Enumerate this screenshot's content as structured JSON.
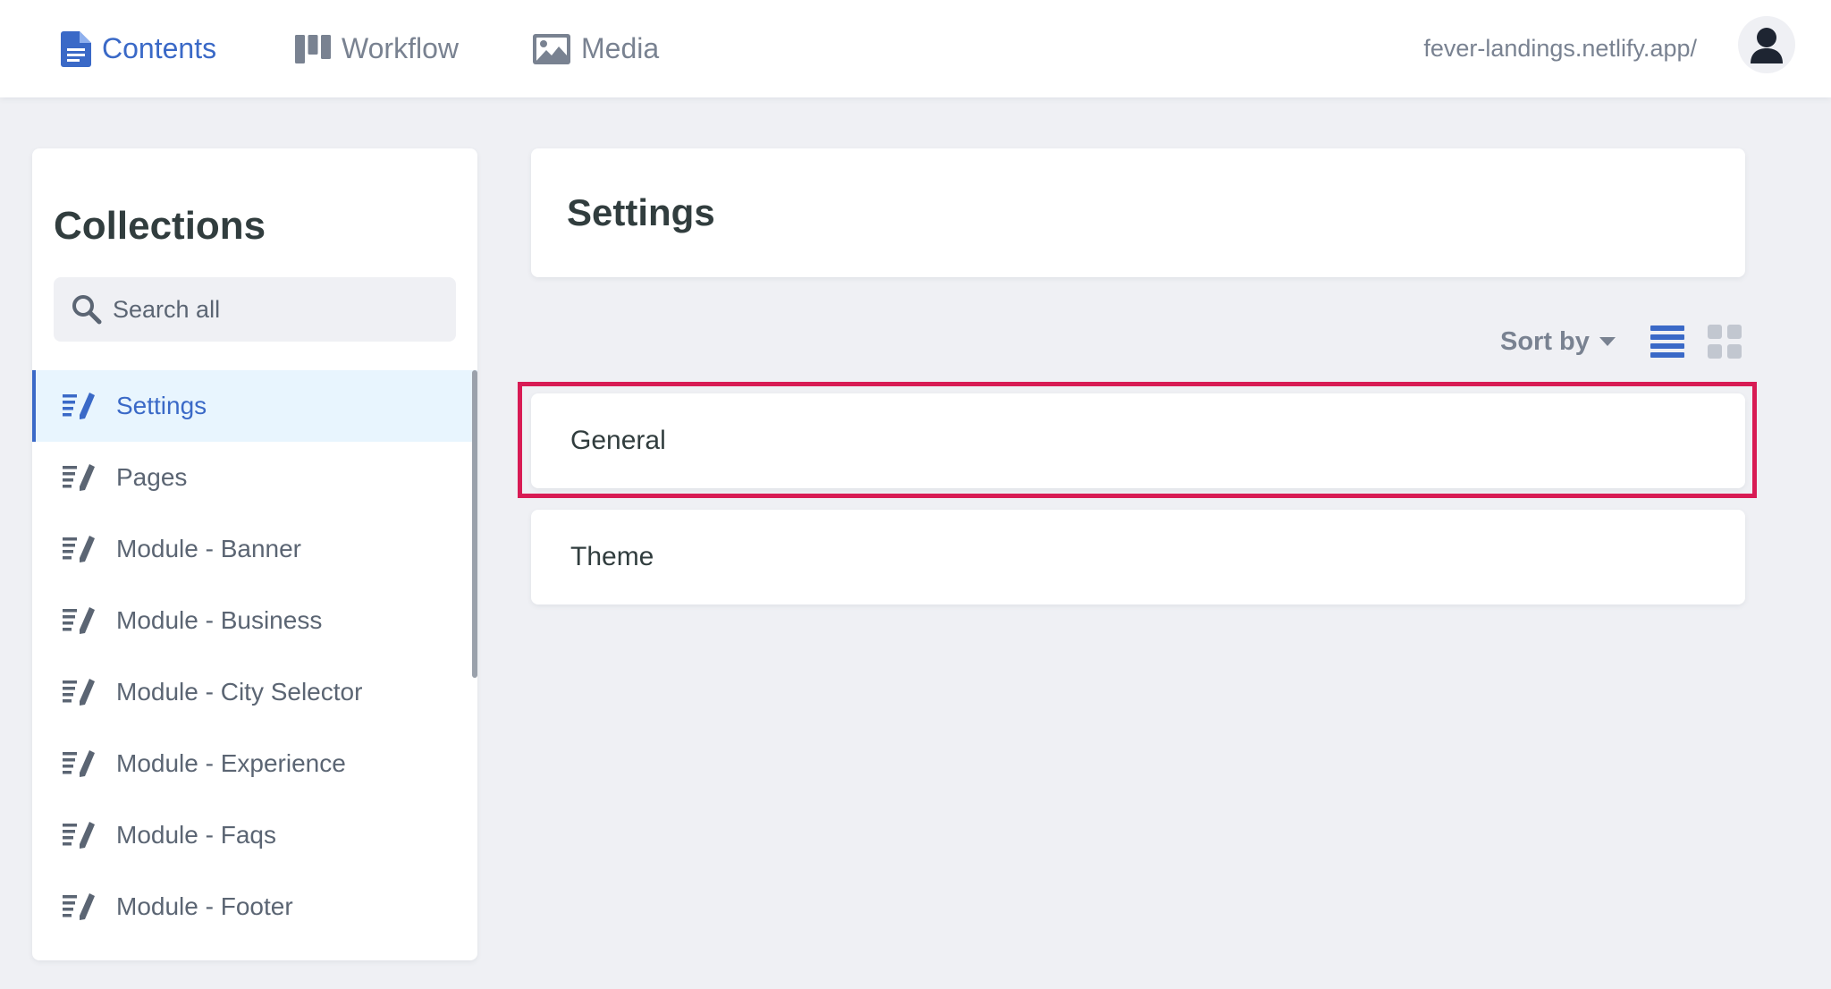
{
  "nav": {
    "items": [
      {
        "label": "Contents",
        "icon": "document-icon",
        "active": true
      },
      {
        "label": "Workflow",
        "icon": "workflow-icon",
        "active": false
      },
      {
        "label": "Media",
        "icon": "image-icon",
        "active": false
      }
    ],
    "site_url": "fever-landings.netlify.app/",
    "avatar_icon": "user-icon"
  },
  "sidebar": {
    "title": "Collections",
    "search": {
      "placeholder": "Search all",
      "value": "",
      "icon": "search-icon"
    },
    "items": [
      {
        "label": "Settings",
        "icon": "collection-icon",
        "active": true
      },
      {
        "label": "Pages",
        "icon": "collection-icon",
        "active": false
      },
      {
        "label": "Module - Banner",
        "icon": "collection-icon",
        "active": false
      },
      {
        "label": "Module - Business",
        "icon": "collection-icon",
        "active": false
      },
      {
        "label": "Module - City Selector",
        "icon": "collection-icon",
        "active": false
      },
      {
        "label": "Module - Experience",
        "icon": "collection-icon",
        "active": false
      },
      {
        "label": "Module - Faqs",
        "icon": "collection-icon",
        "active": false
      },
      {
        "label": "Module - Footer",
        "icon": "collection-icon",
        "active": false
      }
    ]
  },
  "main": {
    "title": "Settings",
    "sort_label": "Sort by",
    "view_modes": [
      {
        "icon": "list-view-icon",
        "active": true
      },
      {
        "icon": "grid-view-icon",
        "active": false
      }
    ],
    "entries": [
      {
        "label": "General",
        "highlighted": true
      },
      {
        "label": "Theme",
        "highlighted": false
      }
    ]
  },
  "colors": {
    "accent": "#3a69c7",
    "muted": "#798291",
    "background": "#eff0f4",
    "active_item_bg": "#e8f5fe",
    "highlight_border": "#d81b54",
    "text": "#313d3e"
  }
}
